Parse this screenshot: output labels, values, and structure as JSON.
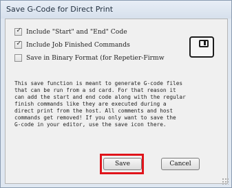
{
  "window": {
    "title": "Save G-Code for Direct Print"
  },
  "options": [
    {
      "label": "Include \"Start\" and \"End\" Code",
      "checked": true
    },
    {
      "label": "Include Job Finished Commands",
      "checked": true
    },
    {
      "label": "Save in Binary Format (for Repetier-Firmw",
      "checked": false
    }
  ],
  "description": [
    "This save function is meant to generate G-code files",
    "that can be run from a sd card. For that reason it",
    "can add the start and end code along with the regular",
    "finish commands like they are executed during a",
    "direct print from the host. All comments and host",
    "commands get removed! If you only want to save the",
    "G-code in your editor, use the save icon there."
  ],
  "buttons": {
    "save_label": "Save",
    "cancel_label": "Cancel"
  },
  "icons": {
    "save": "floppy-disk-icon",
    "check": "✓"
  },
  "colors": {
    "highlight": "#e0141b"
  }
}
